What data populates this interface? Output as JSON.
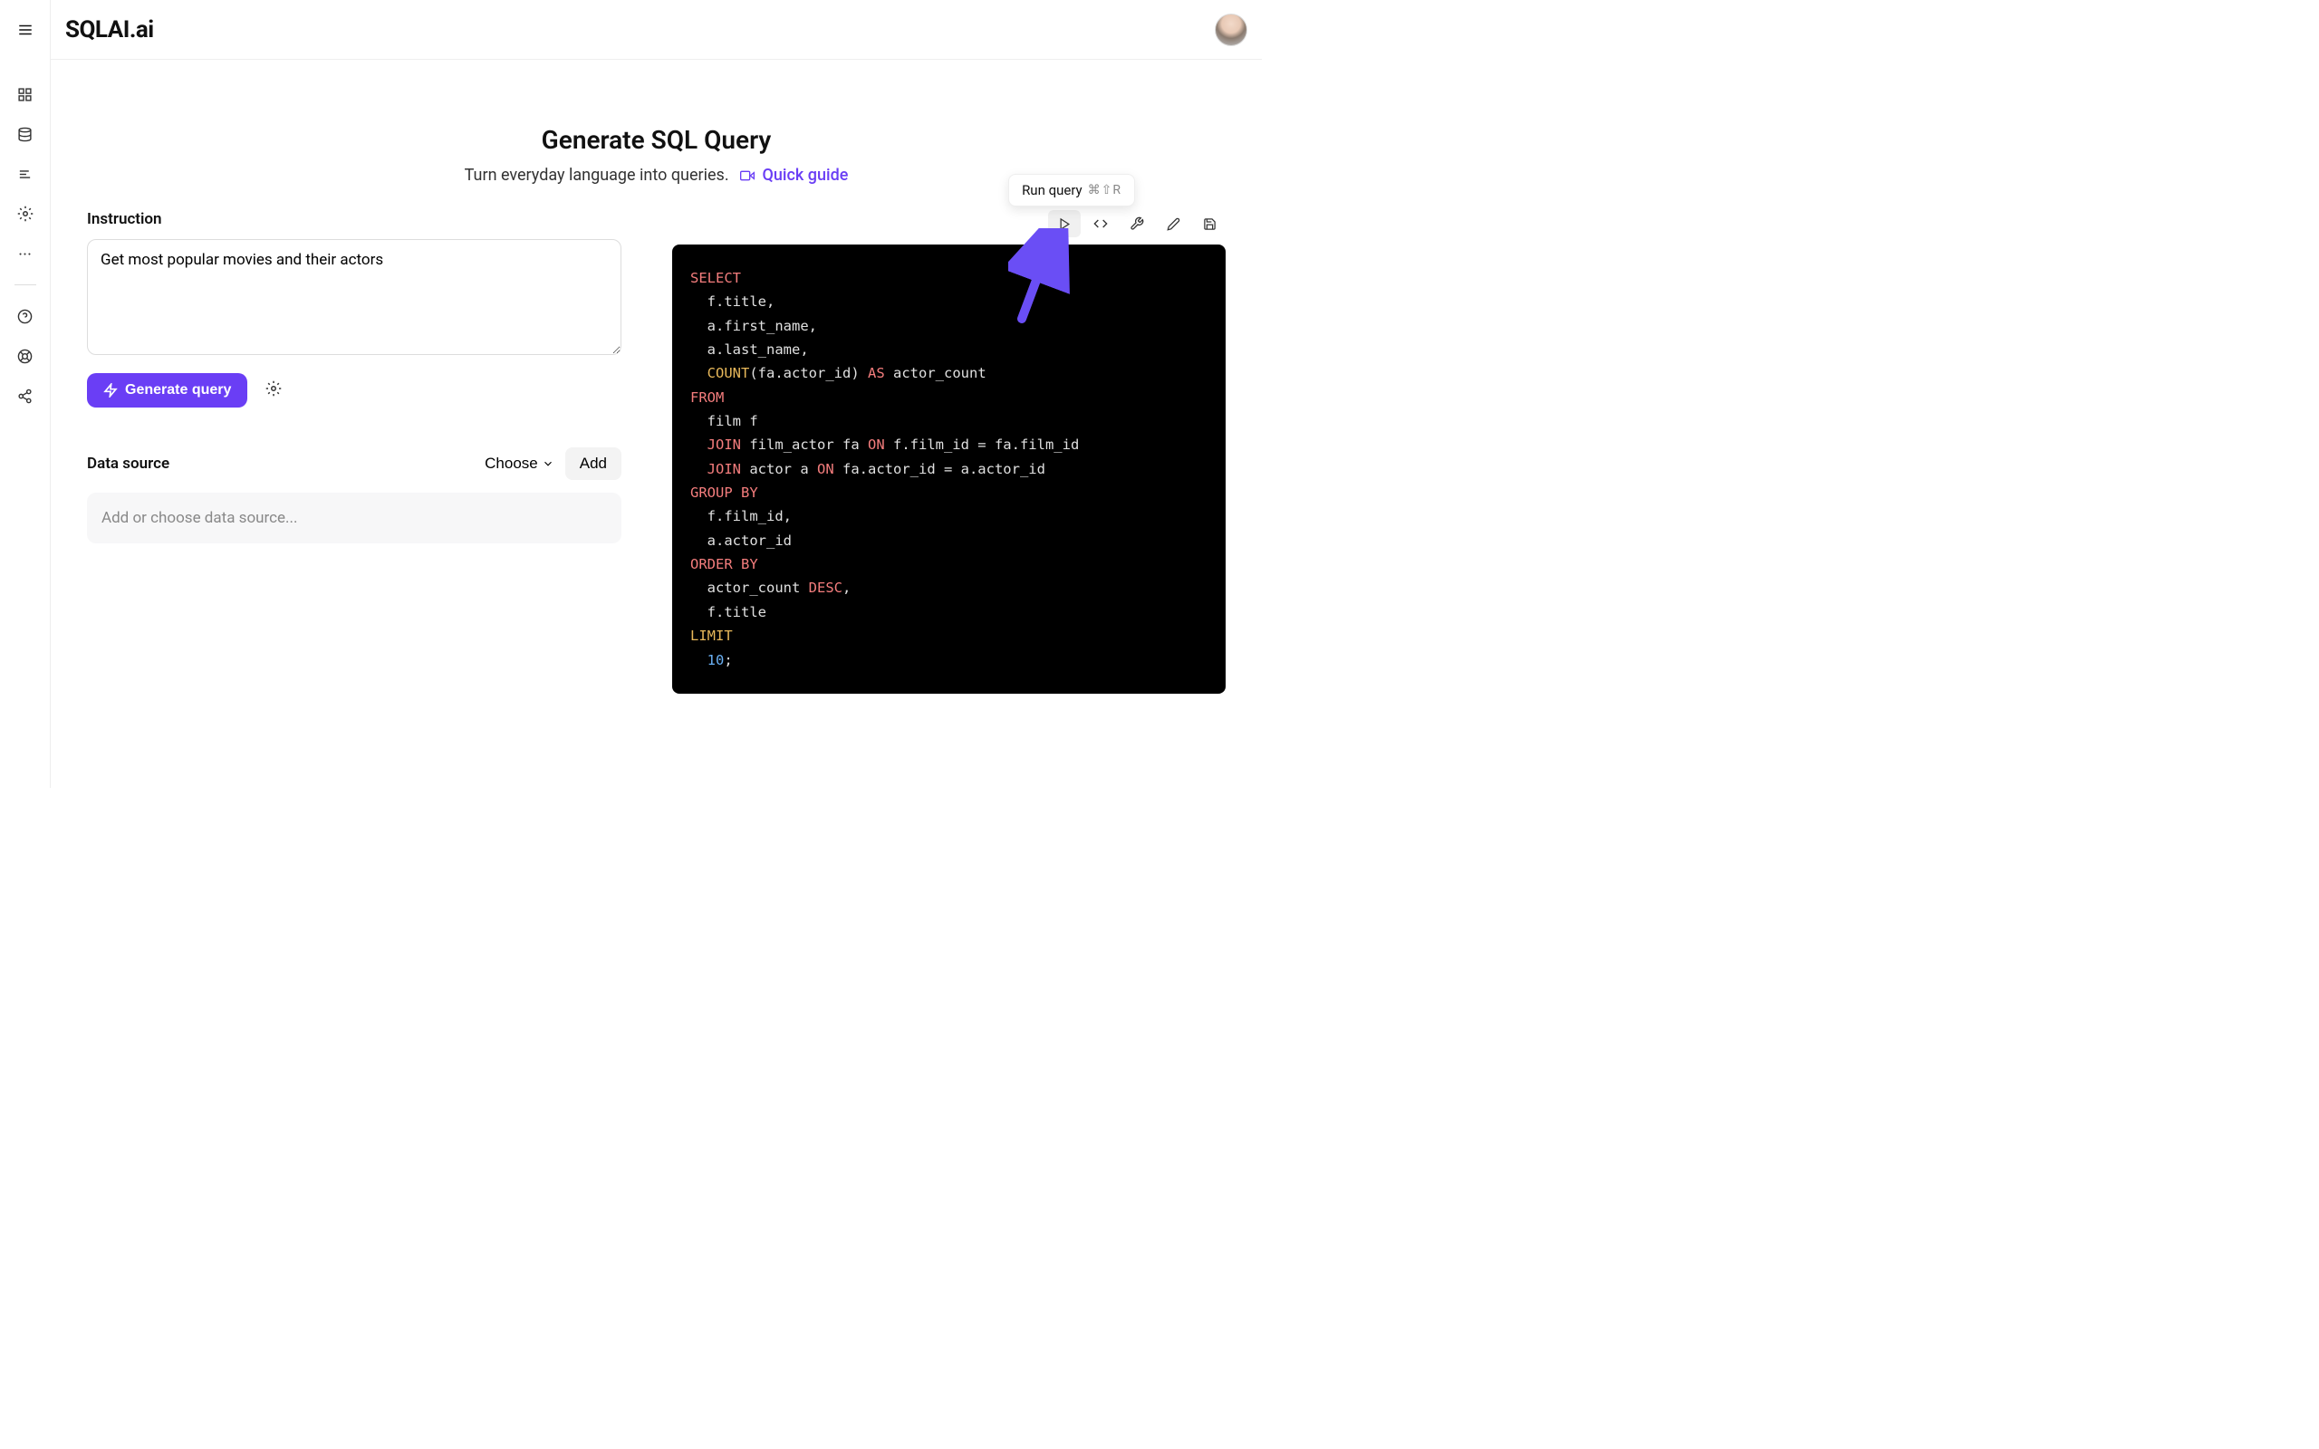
{
  "app_name": "SQLAI.ai",
  "page": {
    "title": "Generate SQL Query",
    "subtitle": "Turn everyday language into queries.",
    "quick_guide": "Quick guide"
  },
  "instruction": {
    "label": "Instruction",
    "value": "Get most popular movies and their actors"
  },
  "actions": {
    "generate": "Generate query"
  },
  "data_source": {
    "label": "Data source",
    "choose": "Choose",
    "add": "Add",
    "placeholder": "Add or choose data source..."
  },
  "tooltip": {
    "label": "Run query",
    "shortcut": "⌘⇧R"
  },
  "sql": {
    "tokens": [
      {
        "t": "SELECT",
        "c": "kw"
      },
      {
        "t": "\n  f.title,\n  a.first_name,\n  a.last_name,\n  ",
        "c": "txt"
      },
      {
        "t": "COUNT",
        "c": "fn"
      },
      {
        "t": "(fa.actor_id) ",
        "c": "txt"
      },
      {
        "t": "AS",
        "c": "kw"
      },
      {
        "t": " actor_count\n",
        "c": "txt"
      },
      {
        "t": "FROM",
        "c": "kw"
      },
      {
        "t": "\n  film f\n  ",
        "c": "txt"
      },
      {
        "t": "JOIN",
        "c": "kw"
      },
      {
        "t": " film_actor fa ",
        "c": "txt"
      },
      {
        "t": "ON",
        "c": "kw"
      },
      {
        "t": " f.film_id = fa.film_id\n  ",
        "c": "txt"
      },
      {
        "t": "JOIN",
        "c": "kw"
      },
      {
        "t": " actor a ",
        "c": "txt"
      },
      {
        "t": "ON",
        "c": "kw"
      },
      {
        "t": " fa.actor_id = a.actor_id\n",
        "c": "txt"
      },
      {
        "t": "GROUP BY",
        "c": "kw"
      },
      {
        "t": "\n  f.film_id,\n  a.actor_id\n",
        "c": "txt"
      },
      {
        "t": "ORDER BY",
        "c": "kw"
      },
      {
        "t": "\n  actor_count ",
        "c": "txt"
      },
      {
        "t": "DESC",
        "c": "kw"
      },
      {
        "t": ",\n  f.title\n",
        "c": "txt"
      },
      {
        "t": "LIMIT",
        "c": "fn"
      },
      {
        "t": "\n  ",
        "c": "txt"
      },
      {
        "t": "10",
        "c": "blue"
      },
      {
        "t": ";",
        "c": "txt"
      }
    ]
  }
}
